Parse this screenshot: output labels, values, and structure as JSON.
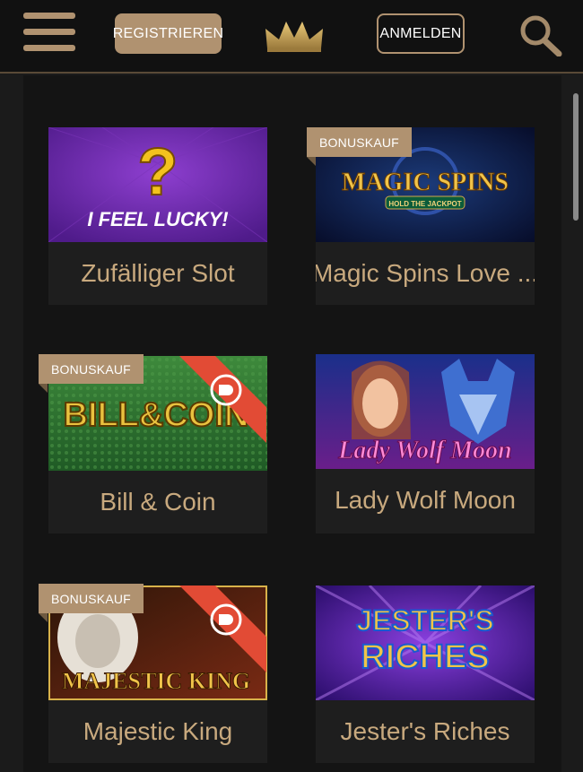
{
  "header": {
    "register_label": "REGISTRIEREN",
    "login_label": "ANMELDEN"
  },
  "games": [
    {
      "title": "Zufälliger Slot",
      "art_text": "I FEEL LUCKY!",
      "badge": ""
    },
    {
      "title": "Magic Spins Love ...",
      "art_text": "MAGIC SPINS",
      "art_subtext": "HOLD THE JACKPOT",
      "badge": "BONUSKAUF"
    },
    {
      "title": "Bill & Coin",
      "art_text": "BILL&COIN",
      "badge": "BONUSKAUF"
    },
    {
      "title": "Lady Wolf Moon",
      "art_text": "Lady Wolf Moon",
      "badge": ""
    },
    {
      "title": "Majestic King",
      "art_text": "MAJESTIC KING",
      "badge": "BONUSKAUF"
    },
    {
      "title": "Jester's Riches",
      "art_text": "JESTER'S",
      "art_subtext": "RICHES",
      "badge": ""
    }
  ],
  "colors": {
    "accent": "#b09270",
    "title_text": "#c8a97e",
    "header_bg": "#111111"
  }
}
